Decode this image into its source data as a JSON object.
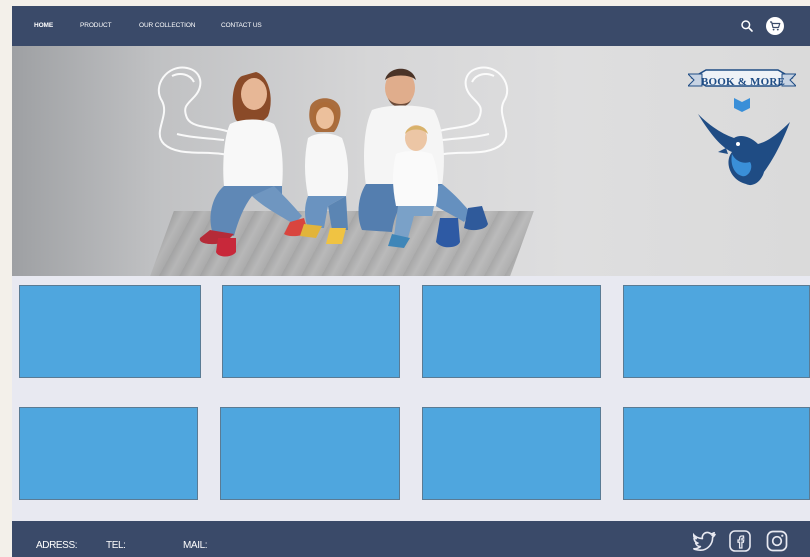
{
  "nav": {
    "items": [
      {
        "label": "HOME"
      },
      {
        "label": "PRODUCT"
      },
      {
        "label": "OUR COLLECTION"
      },
      {
        "label": "CONTACT US"
      }
    ]
  },
  "header": {
    "search_icon": "search-icon",
    "cart_icon": "shopping-cart-icon"
  },
  "hero": {
    "logo_text": "BOOK & MORE"
  },
  "footer": {
    "address_label": "ADRESS:",
    "tel_label": "TEL:",
    "mail_label": "MAIL:",
    "social_icons": [
      "twitter-icon",
      "facebook-icon",
      "instagram-icon"
    ]
  },
  "colors": {
    "nav_bg": "#3a4a69",
    "card_fill": "#4fa6de",
    "page_bg": "#e8e9f1",
    "logo_blue": "#1f4c84"
  }
}
